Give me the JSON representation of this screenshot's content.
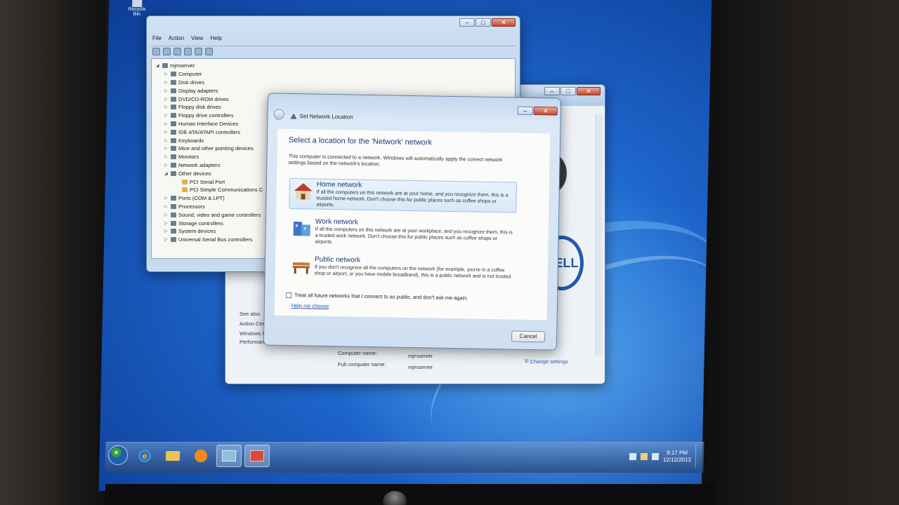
{
  "desktop": {
    "recycle_label": "Recycle Bin"
  },
  "device_manager": {
    "title": "Device Manager",
    "menu": [
      "File",
      "Action",
      "View",
      "Help"
    ],
    "tree": [
      {
        "label": "mjmserver",
        "level": 0,
        "expanded": true
      },
      {
        "label": "Computer",
        "level": 1
      },
      {
        "label": "Disk drives",
        "level": 1
      },
      {
        "label": "Display adapters",
        "level": 1
      },
      {
        "label": "DVD/CD-ROM drives",
        "level": 1
      },
      {
        "label": "Floppy disk drives",
        "level": 1
      },
      {
        "label": "Floppy drive controllers",
        "level": 1
      },
      {
        "label": "Human Interface Devices",
        "level": 1
      },
      {
        "label": "IDE ATA/ATAPI controllers",
        "level": 1
      },
      {
        "label": "Keyboards",
        "level": 1
      },
      {
        "label": "Mice and other pointing devices",
        "level": 1
      },
      {
        "label": "Monitors",
        "level": 1
      },
      {
        "label": "Network adapters",
        "level": 1
      },
      {
        "label": "Other devices",
        "level": 1,
        "expanded": true
      },
      {
        "label": "PCI Serial Port",
        "level": 2,
        "warning": true
      },
      {
        "label": "PCI Simple Communications C",
        "level": 2,
        "warning": true
      },
      {
        "label": "Ports (COM & LPT)",
        "level": 1
      },
      {
        "label": "Processors",
        "level": 1
      },
      {
        "label": "Sound, video and game controllers",
        "level": 1
      },
      {
        "label": "Storage controllers",
        "level": 1
      },
      {
        "label": "System devices",
        "level": 1
      },
      {
        "label": "Universal Serial Bus controllers",
        "level": 1
      }
    ]
  },
  "system_window": {
    "side_links": [
      "See also",
      "Action Center",
      "Windows Update",
      "Performance Information and Tools"
    ],
    "rows": [
      {
        "label": "Computer name:",
        "value": "mjmserver"
      },
      {
        "label": "Full computer name:",
        "value": "mjmserver"
      }
    ],
    "change_settings": "Change settings",
    "oem_logo": "DELL"
  },
  "dialog": {
    "title": "Set Network Location",
    "heading": "Select a location for the 'Network' network",
    "intro": "This computer is connected to a network. Windows will automatically apply the correct network settings based on the network's location.",
    "options": [
      {
        "title": "Home network",
        "icon": "home-network-icon",
        "desc": "If all the computers on this network are at your home, and you recognize them, this is a trusted home network. Don't choose this for public places such as coffee shops or airports.",
        "selected": true
      },
      {
        "title": "Work network",
        "icon": "work-network-icon",
        "desc": "If all the computers on this network are at your workplace, and you recognize them, this is a trusted work network. Don't choose this for public places such as coffee shops or airports.",
        "selected": false
      },
      {
        "title": "Public network",
        "icon": "public-network-icon",
        "desc": "If you don't recognize all the computers on the network (for example, you're in a coffee shop or airport, or you have mobile broadband), this is a public network and is not trusted.",
        "selected": false
      }
    ],
    "checkbox_label": "Treat all future networks that I connect to as public, and don't ask me again.",
    "help_link": "Help me choose",
    "cancel_label": "Cancel"
  },
  "taskbar": {
    "apps": [
      "internet-explorer-icon",
      "explorer-folder-icon",
      "media-player-icon",
      "control-panel-icon",
      "red-app-icon"
    ],
    "clock_time": "9:17 PM",
    "clock_date": "12/12/2013"
  }
}
